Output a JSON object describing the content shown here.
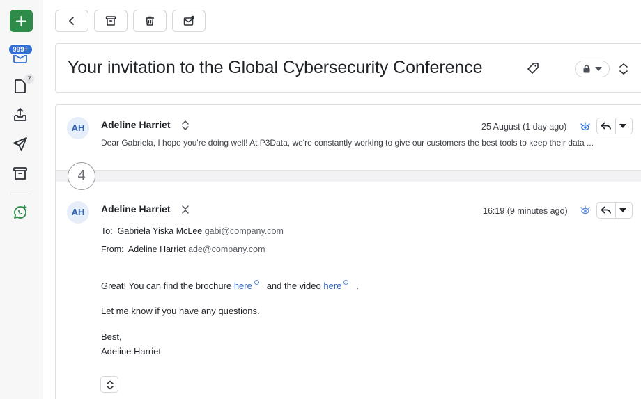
{
  "rail": {
    "inbox_badge": "999+",
    "drafts_count": "7"
  },
  "subject": {
    "title": "Your invitation to the Global Cybersecurity Conference"
  },
  "thread": {
    "collapsed_count": "4",
    "messages": [
      {
        "avatar": "AH",
        "sender": "Adeline Harriet",
        "date": "25 August (1 day ago)",
        "snippet": "Dear Gabriela, I hope you're doing well! At P3Data, we're constantly working to give our customers the best tools to keep their data ..."
      },
      {
        "avatar": "AH",
        "sender": "Adeline Harriet",
        "date": "16:19 (9 minutes ago)",
        "to_label": "To:",
        "to_name": "Gabriela Yiska McLee",
        "to_email": "gabi@company.com",
        "from_label": "From:",
        "from_name": "Adeline Harriet",
        "from_email": "ade@company.com",
        "body": {
          "line1_a": "Great! You can find the brochure",
          "link1": "here",
          "line1_b": "and the video",
          "link2": "here",
          "line1_c": ".",
          "line2": "Let me know if you have any questions.",
          "line3": "Best,",
          "line4": "Adeline Harriet"
        }
      }
    ]
  },
  "colors": {
    "accent": "#2e8b4a",
    "badge": "#2f6fd6",
    "link": "#2f64b8"
  }
}
